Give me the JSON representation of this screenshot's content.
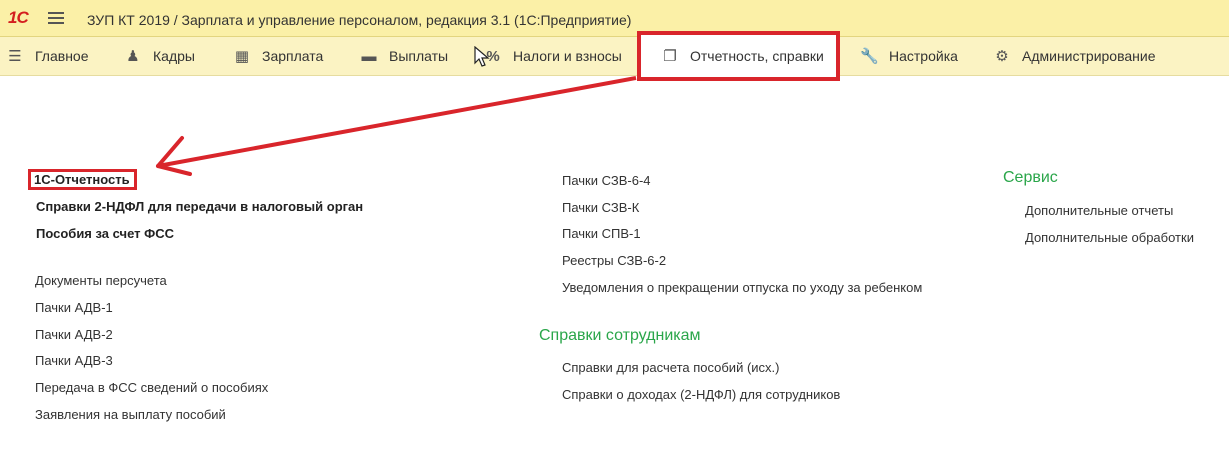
{
  "window": {
    "logo_text": "1С",
    "title": "ЗУП КТ 2019 / Зарплата и управление персоналом, редакция 3.1  (1С:Предприятие)"
  },
  "menu": [
    {
      "label": "Главное",
      "icon": "list-icon"
    },
    {
      "label": "Кадры",
      "icon": "people-icon"
    },
    {
      "label": "Зарплата",
      "icon": "calculator-icon"
    },
    {
      "label": "Выплаты",
      "icon": "wallet-icon"
    },
    {
      "label": "Налоги и взносы",
      "icon": "percent-icon"
    },
    {
      "label": "Отчетность, справки",
      "icon": "documents-icon",
      "active": true
    },
    {
      "label": "Настройка",
      "icon": "wrench-icon"
    },
    {
      "label": "Администрирование",
      "icon": "gear-icon"
    }
  ],
  "left_column": {
    "primary": [
      "1С-Отчетность",
      "Справки 2-НДФЛ для передачи в налоговый орган",
      "Пособия за счет ФСС"
    ],
    "secondary": [
      "Документы персучета",
      "Пачки АДВ-1",
      "Пачки АДВ-2",
      "Пачки АДВ-3",
      "Передача в ФСС сведений о пособиях",
      "Заявления на выплату пособий"
    ]
  },
  "middle_column": {
    "items": [
      "Пачки СЗВ-6-4",
      "Пачки СЗВ-К",
      "Пачки СПВ-1",
      "Реестры СЗВ-6-2",
      "Уведомления о прекращении отпуска по уходу за ребенком"
    ],
    "section_title": "Справки сотрудникам",
    "section_items": [
      "Справки для расчета пособий (исх.)",
      "Справки о доходах (2-НДФЛ) для сотрудников"
    ]
  },
  "right_column": {
    "section_title": "Сервис",
    "items": [
      "Дополнительные отчеты",
      "Дополнительные обработки"
    ]
  },
  "colors": {
    "accent_red": "#d9252b",
    "section_green": "#2aa64a",
    "titlebar": "#fbf0a7"
  }
}
